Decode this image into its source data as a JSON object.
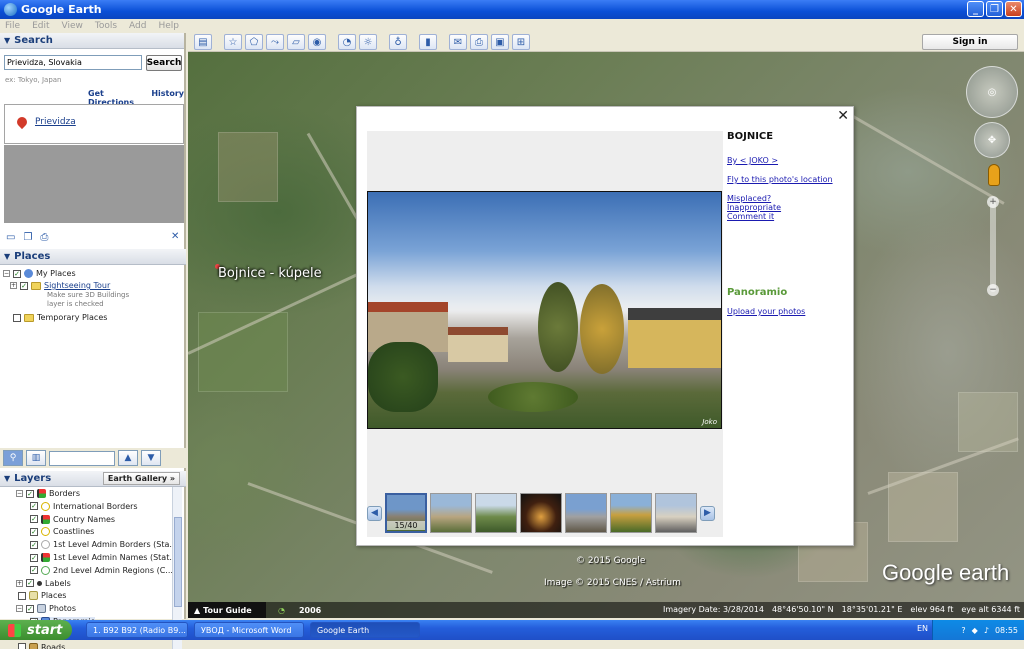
{
  "window": {
    "title": "Google Earth"
  },
  "menu": [
    "File",
    "Edit",
    "View",
    "Tools",
    "Add",
    "Help"
  ],
  "toolbar": {
    "signin_label": "Sign in"
  },
  "search": {
    "section_title": "Search",
    "query_value": "Prievidza, Slovakia",
    "button_label": "Search",
    "hint": "ex: Tokyo, Japan",
    "get_directions": "Get Directions",
    "history": "History",
    "result": "Prievidza"
  },
  "places": {
    "section_title": "Places",
    "my_places": "My Places",
    "sightseeing_tour": "Sightseeing Tour",
    "sightseeing_note_1": "Make sure 3D Buildings",
    "sightseeing_note_2": "layer is checked",
    "temporary_places": "Temporary Places"
  },
  "layers": {
    "section_title": "Layers",
    "earth_gallery": "Earth Gallery",
    "items": [
      {
        "label": "Borders",
        "indent": 1,
        "icon": "flag"
      },
      {
        "label": "International Borders",
        "indent": 2,
        "icon": "line-yellow"
      },
      {
        "label": "Country Names",
        "indent": 2,
        "icon": "flag"
      },
      {
        "label": "Coastlines",
        "indent": 2,
        "icon": "line-yellow"
      },
      {
        "label": "1st Level Admin Borders (Sta...",
        "indent": 2,
        "icon": "line-grey"
      },
      {
        "label": "1st Level Admin Names (Stat...",
        "indent": 2,
        "icon": "flag"
      },
      {
        "label": "2nd Level Admin Regions (C...",
        "indent": 2,
        "icon": "line-green"
      },
      {
        "label": "Labels",
        "indent": 1,
        "icon": "dot"
      },
      {
        "label": "Places",
        "indent": 1,
        "icon": "square"
      },
      {
        "label": "Photos",
        "indent": 1,
        "icon": "photo"
      },
      {
        "label": "Panoramio",
        "indent": 2,
        "icon": "photo-blue"
      },
      {
        "label": "360 Cities",
        "indent": 2,
        "icon": "photo-red"
      },
      {
        "label": "Roads",
        "indent": 1,
        "icon": "road"
      }
    ]
  },
  "map": {
    "place_label": "Bojnice - kúpele",
    "copyright_1": "© 2015 Google",
    "copyright_2": "Image © 2015 CNES / Astrium",
    "logo": "Google earth",
    "tour_guide": "Tour Guide",
    "history_year": "2006",
    "imagery_date": "Imagery Date: 3/28/2014",
    "lat": "48°46'50.10\" N",
    "lon": "18°35'01.21\" E",
    "elev": "elev  964 ft",
    "eye_alt": "eye alt  6344 ft"
  },
  "popup": {
    "title": "BOJNICE",
    "by": "By < JOKO >",
    "fly_to": "Fly to this photo's location",
    "misplaced": "Misplaced?",
    "inappropriate": "Inappropriate",
    "comment": "Comment it",
    "panoramio": "Panoramio",
    "upload": "Upload your photos",
    "photo_author": "Joko",
    "counter": "15/40"
  },
  "taskbar": {
    "start": "start",
    "tasks": [
      "1. B92 B92 (Radio B9...",
      "УВОД - Microsoft Word",
      "Google Earth"
    ],
    "lang": "EN",
    "time": "08:55"
  }
}
